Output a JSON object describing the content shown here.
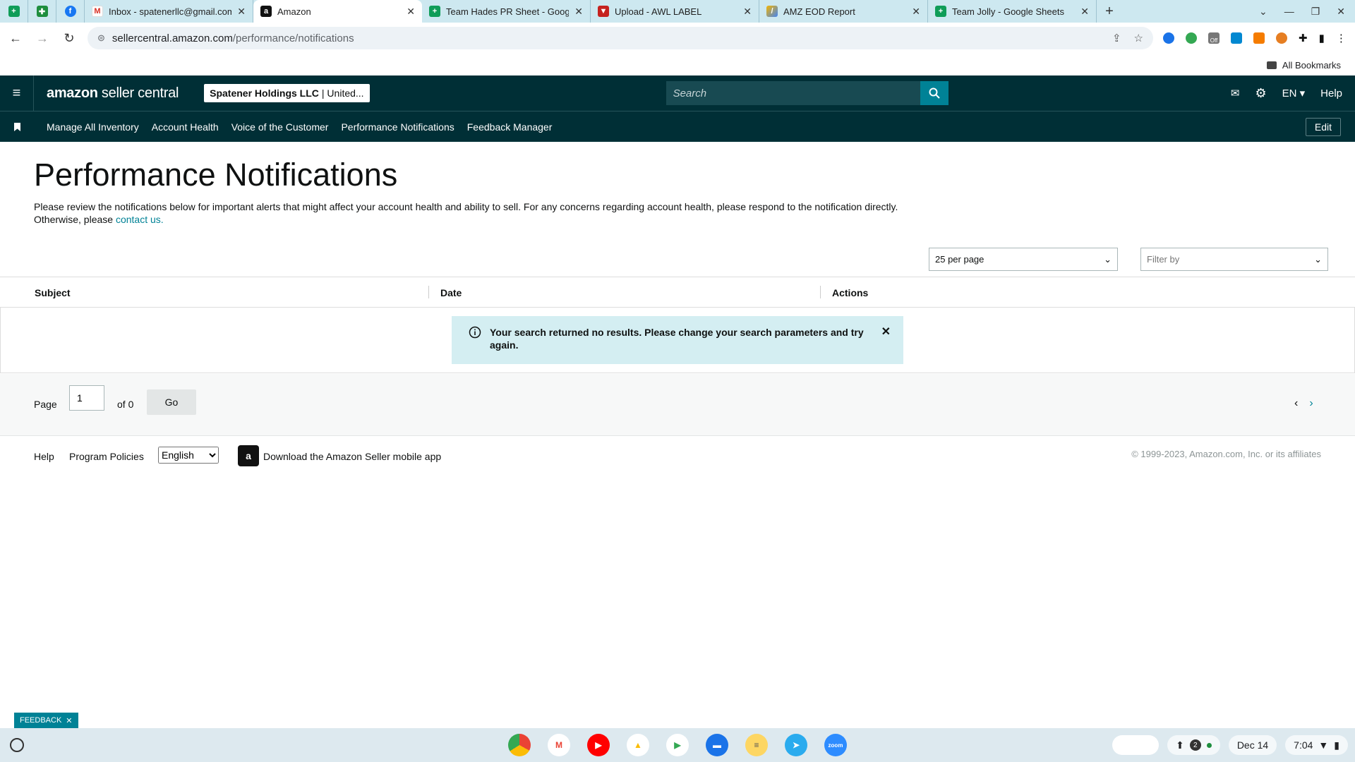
{
  "browser": {
    "tabs": [
      {
        "title": "Inbox - spatenerllc@gmail.com",
        "icon": "gmail-icon",
        "active": false
      },
      {
        "title": "Amazon",
        "icon": "amazon-icon",
        "active": true
      },
      {
        "title": "Team Hades PR Sheet - Google",
        "icon": "sheets-icon",
        "active": false
      },
      {
        "title": "Upload - AWL LABEL",
        "icon": "awl-icon",
        "active": false
      },
      {
        "title": "AMZ EOD Report",
        "icon": "report-icon",
        "active": false
      },
      {
        "title": "Team Jolly - Google Sheets",
        "icon": "sheets-icon",
        "active": false
      }
    ],
    "url_host": "sellercentral.amazon.com",
    "url_path": "/performance/notifications",
    "bookmarks_label": "All Bookmarks",
    "ext_badge": "Off"
  },
  "header": {
    "logo_bold": "amazon",
    "logo_rest": " seller central",
    "account_name": "Spatener Holdings LLC",
    "account_region": "| United...",
    "search_placeholder": "Search",
    "language": "EN",
    "help": "Help"
  },
  "subnav": {
    "items": [
      "Manage All Inventory",
      "Account Health",
      "Voice of the Customer",
      "Performance Notifications",
      "Feedback Manager"
    ],
    "edit": "Edit"
  },
  "main": {
    "title": "Performance Notifications",
    "intro": "Please review the notifications below for important alerts that might affect your account health and ability to sell. For any concerns regarding account health, please respond to the notification directly. Otherwise, please ",
    "contact_link": "contact us.",
    "per_page": "25 per page",
    "filter_placeholder": "Filter by",
    "columns": [
      "Subject",
      "Date",
      "Actions"
    ],
    "empty_message": "Your search returned no results. Please change your search parameters and try again."
  },
  "pagination": {
    "page_label": "Page",
    "page_value": "1",
    "of_label": "of 0",
    "go": "Go"
  },
  "footer": {
    "help": "Help",
    "policies": "Program Policies",
    "language": "English",
    "app_download": "Download the Amazon Seller mobile app",
    "copyright": "© 1999-2023, Amazon.com, Inc. or its affiliates"
  },
  "feedback": "FEEDBACK",
  "shelf": {
    "badge_count": "2",
    "date": "Dec 14",
    "time": "7:04"
  },
  "colors": {
    "header_bg": "#002f36",
    "accent": "#008296",
    "alert_bg": "#d4eef2"
  }
}
